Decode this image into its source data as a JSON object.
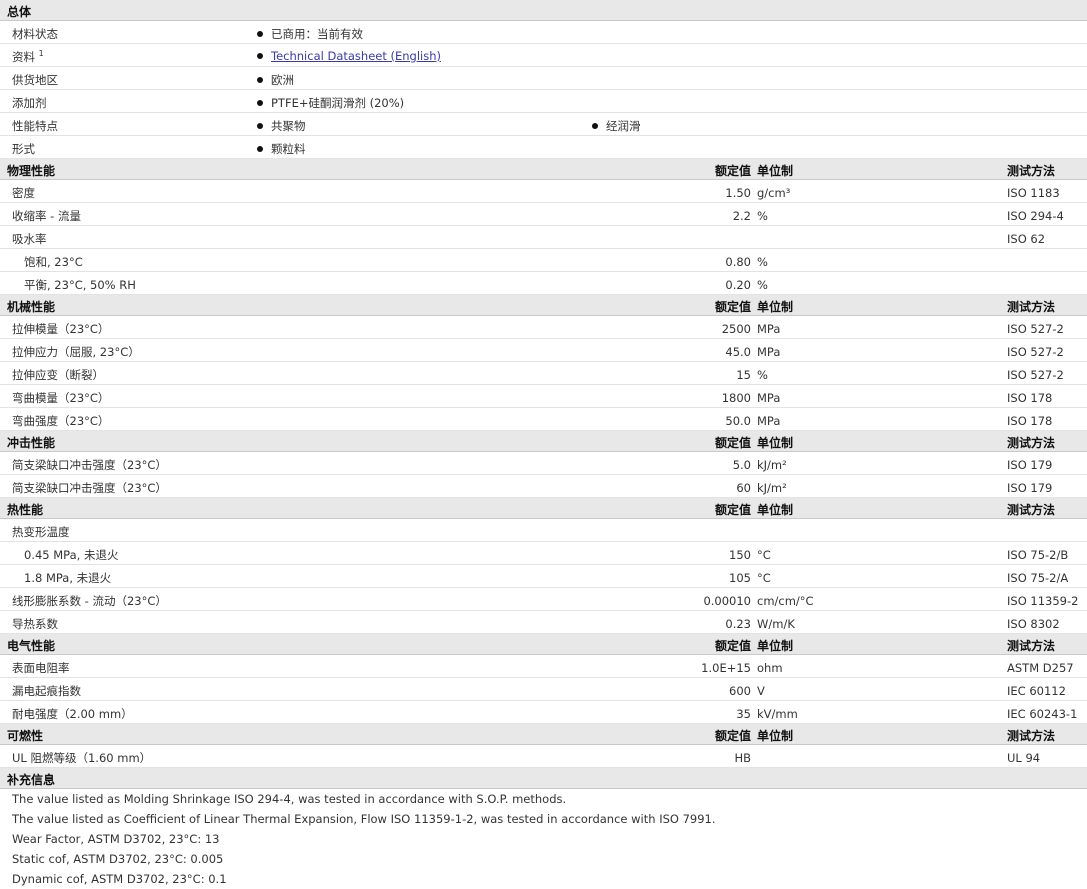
{
  "general": {
    "header": "总体",
    "rows": [
      {
        "label": "材料状态",
        "items": [
          "已商用：当前有效"
        ]
      },
      {
        "label": "资料",
        "sup": "1",
        "link": "Technical Datasheet (English)"
      },
      {
        "label": "供货地区",
        "items": [
          "欧洲"
        ]
      },
      {
        "label": "添加剂",
        "items": [
          "PTFE+硅酮润滑剂 (20%)"
        ]
      },
      {
        "label": "性能特点",
        "items": [
          "共聚物",
          "经润滑"
        ]
      },
      {
        "label": "形式",
        "items": [
          "颗粒料"
        ]
      }
    ]
  },
  "col_headers": {
    "value": "额定值",
    "unit": "单位制",
    "method": "测试方法"
  },
  "sections": [
    {
      "title": "物理性能",
      "rows": [
        {
          "label": "密度",
          "value": "1.50",
          "unit": "g/cm³",
          "method": "ISO 1183"
        },
        {
          "label": "收缩率  - 流量",
          "value": "2.2",
          "unit": "%",
          "method": "ISO 294-4"
        },
        {
          "label": "吸水率",
          "value": "",
          "unit": "",
          "method": "ISO 62"
        },
        {
          "label": "饱和, 23°C",
          "value": "0.80",
          "unit": "%",
          "method": "",
          "sub": true
        },
        {
          "label": "平衡, 23°C, 50% RH",
          "value": "0.20",
          "unit": "%",
          "method": "",
          "sub": true
        }
      ]
    },
    {
      "title": "机械性能",
      "rows": [
        {
          "label": "拉伸模量（23°C）",
          "value": "2500",
          "unit": "MPa",
          "method": "ISO 527-2"
        },
        {
          "label": "拉伸应力（屈服, 23°C）",
          "value": "45.0",
          "unit": "MPa",
          "method": "ISO 527-2"
        },
        {
          "label": "拉伸应变（断裂）",
          "value": "15",
          "unit": "%",
          "method": "ISO 527-2"
        },
        {
          "label": "弯曲模量（23°C）",
          "value": "1800",
          "unit": "MPa",
          "method": "ISO 178"
        },
        {
          "label": "弯曲强度（23°C）",
          "value": "50.0",
          "unit": "MPa",
          "method": "ISO 178"
        }
      ]
    },
    {
      "title": "冲击性能",
      "rows": [
        {
          "label": "简支梁缺口冲击强度（23°C）",
          "value": "5.0",
          "unit": "kJ/m²",
          "method": "ISO 179"
        },
        {
          "label": "简支梁缺口冲击强度（23°C）",
          "value": "60",
          "unit": "kJ/m²",
          "method": "ISO 179"
        }
      ]
    },
    {
      "title": "热性能",
      "rows": [
        {
          "label": "热变形温度",
          "value": "",
          "unit": "",
          "method": ""
        },
        {
          "label": "0.45 MPa, 未退火",
          "value": "150",
          "unit": "°C",
          "method": "ISO 75-2/B",
          "sub": true
        },
        {
          "label": "1.8 MPa, 未退火",
          "value": "105",
          "unit": "°C",
          "method": "ISO 75-2/A",
          "sub": true
        },
        {
          "label": "线形膨胀系数  - 流动（23°C）",
          "value": "0.00010",
          "unit": "cm/cm/°C",
          "method": "ISO 11359-2"
        },
        {
          "label": "导热系数",
          "value": "0.23",
          "unit": "W/m/K",
          "method": "ISO 8302"
        }
      ]
    },
    {
      "title": "电气性能",
      "rows": [
        {
          "label": "表面电阻率",
          "value": "1.0E+15",
          "unit": "ohm",
          "method": "ASTM D257"
        },
        {
          "label": "漏电起痕指数",
          "value": "600",
          "unit": "V",
          "method": "IEC 60112"
        },
        {
          "label": "耐电强度（2.00 mm）",
          "value": "35",
          "unit": "kV/mm",
          "method": "IEC 60243-1"
        }
      ]
    },
    {
      "title": "可燃性",
      "rows": [
        {
          "label": "UL 阻燃等级（1.60 mm）",
          "value": "HB",
          "unit": "",
          "method": "UL 94"
        }
      ]
    }
  ],
  "supplement": {
    "title": "补充信息",
    "notes": [
      "The value listed as Molding Shrinkage ISO 294-4, was tested in accordance with S.O.P. methods.",
      "The value listed as Coefficient of Linear Thermal Expansion, Flow ISO 11359-1-2, was tested in accordance with ISO 7991.",
      "Wear Factor, ASTM D3702, 23°C: 13",
      "Static cof, ASTM D3702, 23°C: 0.005",
      "Dynamic cof, ASTM D3702, 23°C: 0.1"
    ]
  }
}
